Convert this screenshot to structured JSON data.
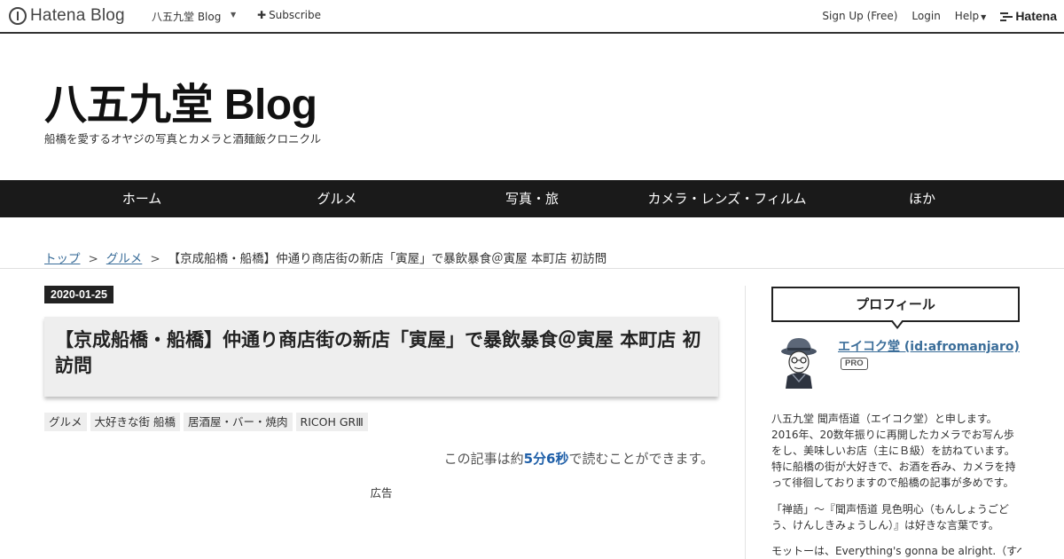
{
  "topbar": {
    "logo_text": "Hatena Blog",
    "blog_name": "八五九堂 Blog",
    "subscribe_icon": "plus-icon",
    "subscribe_label": "Subscribe",
    "signup_label": "Sign Up (Free)",
    "login_label": "Login",
    "help_label": "Help",
    "hatena_label": "Hatena"
  },
  "header": {
    "title": "八五九堂 Blog",
    "description": "船橋を愛するオヤジの写真とカメラと酒麺飯クロニクル"
  },
  "nav": {
    "items": [
      {
        "label": "ホーム"
      },
      {
        "label": "グルメ"
      },
      {
        "label": "写真・旅"
      },
      {
        "label": "カメラ・レンズ・フィルム"
      },
      {
        "label": "ほか"
      }
    ]
  },
  "breadcrumb": {
    "top": "トップ",
    "category": "グルメ",
    "separator": ">",
    "current": "【京成船橋・船橋】仲通り商店街の新店「寅屋」で暴飲暴食＠寅屋 本町店 初訪問"
  },
  "article": {
    "date": "2020-01-25",
    "title": "【京成船橋・船橋】仲通り商店街の新店「寅屋」で暴飲暴食＠寅屋 本町店 初訪問",
    "tags": [
      "グルメ",
      "大好きな街 船橋",
      "居酒屋・バー・焼肉",
      "RICOH GRⅢ"
    ],
    "readtime_prefix": "この記事は約",
    "readtime_value": "5分6秒",
    "readtime_suffix": "で読むことができます。",
    "ad_label": "広告"
  },
  "sidebar": {
    "profile_heading": "プロフィール",
    "profile_name": "エイコク堂 (id:afromanjaro)",
    "pro_badge": "PRO",
    "profile_text_1": "八五九堂 聞声悟道（エイコク堂）と申します。2016年、20数年振りに再開したカメラでお写ん歩をし、美味しいお店（主にＢ級）を訪ねています。特に船橋の街が大好きで、お酒を呑み、カメラを持って徘徊しておりますので船橋の記事が多めです。",
    "profile_text_2": "「禅語」～『聞声悟道 見色明心（もんしょうごどう、けんしきみょうしん）』は好きな言葉です。",
    "profile_text_3": "モットーは、Everything's gonna be alright.（すべ"
  },
  "colors": {
    "nav_bg": "#1a1a1a",
    "link": "#3a6d99",
    "readtime_accent": "#1f5fa8",
    "title_box_bg": "#eeeeee"
  }
}
